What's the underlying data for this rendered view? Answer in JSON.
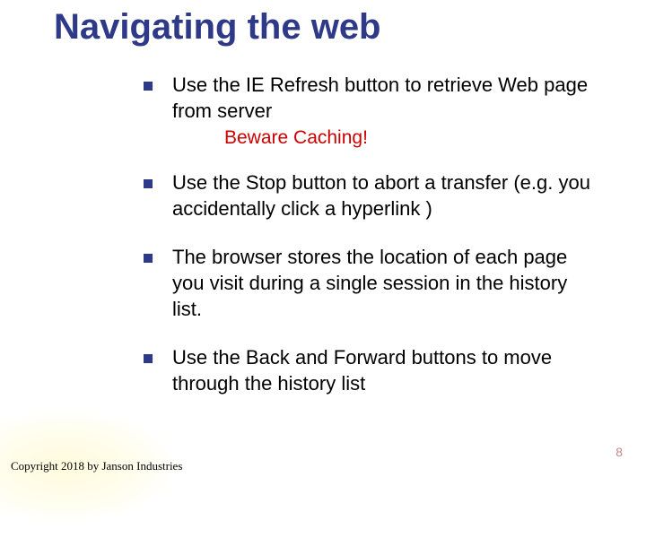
{
  "title": "Navigating the web",
  "bullets": {
    "b1": "Use the IE Refresh button to retrieve Web page from server",
    "b1_warning": "Beware Caching!",
    "b2": "Use the Stop button to abort a transfer (e.g. you accidentally click a hyperlink )",
    "b3": "The browser stores the location of each page you visit during a single session in the history list.",
    "b4": "Use the Back and Forward buttons to move through the history list"
  },
  "copyright": "Copyright 2018 by Janson Industries",
  "page_number": "8"
}
